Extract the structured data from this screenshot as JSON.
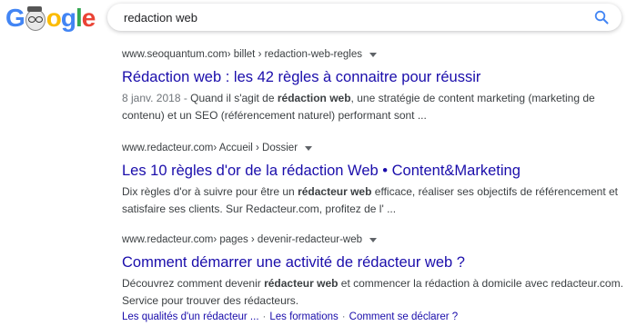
{
  "header": {
    "logo": {
      "letters": [
        "G",
        "o",
        "g",
        "l",
        "e"
      ],
      "colors": {
        "blue": "#4285f4",
        "red": "#ea4335",
        "yellow": "#fbbc05",
        "green": "#34a853"
      },
      "doodle_icon": "doodle-portrait-icon"
    },
    "search": {
      "value": "redaction web",
      "icon": "search-icon",
      "icon_color": "#4285f4"
    }
  },
  "results": [
    {
      "cite_domain": "www.seoquantum.com",
      "cite_path": " › billet › redaction-web-regles",
      "title": "Rédaction web : les 42 règles à connaitre pour réussir",
      "snippet": {
        "date": "8 janv. 2018 - ",
        "parts": [
          "Quand il s'agit de ",
          "rédaction web",
          ", une stratégie de content marketing (marketing de contenu) et un SEO (référencement naturel) performant sont ..."
        ]
      }
    },
    {
      "cite_domain": "www.redacteur.com",
      "cite_path": " › Accueil › Dossier",
      "title": "Les 10 règles d'or de la rédaction Web • Content&Marketing",
      "snippet": {
        "parts": [
          "Dix règles d'or à suivre pour être un ",
          "rédacteur web",
          " efficace, réaliser ses objectifs de référencement et satisfaire ses clients. Sur Redacteur.com, profitez de l' ..."
        ]
      }
    },
    {
      "cite_domain": "www.redacteur.com",
      "cite_path": " › pages › devenir-redacteur-web",
      "title": "Comment démarrer une activité de rédacteur web ?",
      "snippet": {
        "parts": [
          "Découvrez comment devenir ",
          "rédacteur web",
          " et commencer la rédaction à domicile avec redacteur.com. Service pour trouver des rédacteurs."
        ]
      },
      "sitelinks": [
        "Les qualités d'un rédacteur ...",
        "Les formations",
        "Comment se déclarer ?"
      ],
      "sitelink_separator": "·"
    }
  ],
  "colors": {
    "link": "#1a0dab",
    "text": "#3c4043",
    "muted": "#70757a"
  }
}
